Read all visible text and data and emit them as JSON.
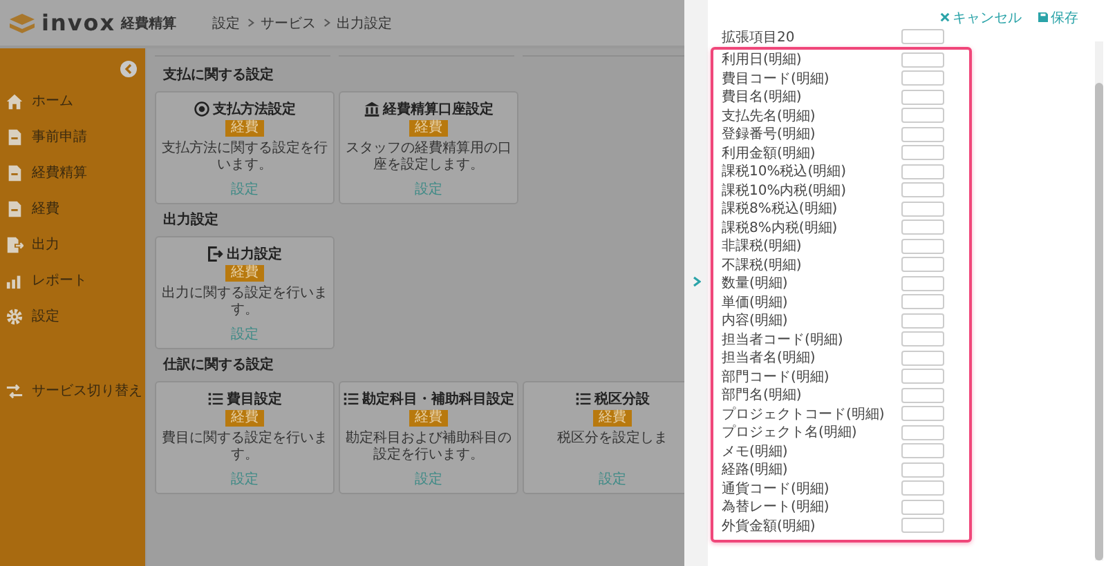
{
  "header": {
    "logo_text": "invox",
    "product": "経費精算",
    "breadcrumb": [
      "設定",
      "サービス",
      "出力設定"
    ]
  },
  "sidebar": {
    "items": [
      {
        "label": "ホーム"
      },
      {
        "label": "事前申請"
      },
      {
        "label": "経費精算"
      },
      {
        "label": "経費"
      },
      {
        "label": "出力"
      },
      {
        "label": "レポート"
      },
      {
        "label": "設定"
      }
    ],
    "footer_item": {
      "label": "サービス切り替え"
    }
  },
  "sections": [
    {
      "title": "支払に関する設定",
      "cards": [
        {
          "title": "支払方法設定",
          "badge": "経費",
          "description": "支払方法に関する設定を行います。",
          "link": "設定"
        },
        {
          "title": "経費精算口座設定",
          "badge": "経費",
          "description": "スタッフの経費精算用の口座を設定します。",
          "link": "設定"
        }
      ]
    },
    {
      "title": "出力設定",
      "cards": [
        {
          "title": "出力設定",
          "badge": "経費",
          "description": "出力に関する設定を行います。",
          "link": "設定"
        }
      ]
    },
    {
      "title": "仕訳に関する設定",
      "cards": [
        {
          "title": "費目設定",
          "badge": "経費",
          "description": "費目に関する設定を行います。",
          "link": "設定"
        },
        {
          "title": "勘定科目・補助科目設定",
          "badge": "経費",
          "description": "勘定科目および補助科目の設定を行います。",
          "link": "設定"
        },
        {
          "title": "税区分設",
          "badge": "経費",
          "description": "税区分を設定しま",
          "link": "設定"
        }
      ]
    }
  ],
  "panel": {
    "actions": [
      {
        "label": "キャンセル",
        "kind": "cancel"
      },
      {
        "label": "保存",
        "kind": "save"
      }
    ],
    "fields": [
      {
        "label": "拡張項目20"
      }
    ],
    "highlighted_fields": [
      {
        "label": "利用日(明細)"
      },
      {
        "label": "費目コード(明細)"
      },
      {
        "label": "費目名(明細)"
      },
      {
        "label": "支払先名(明細)"
      },
      {
        "label": "登録番号(明細)"
      },
      {
        "label": "利用金額(明細)"
      },
      {
        "label": "課税10%税込(明細)"
      },
      {
        "label": "課税10%内税(明細)"
      },
      {
        "label": "課税8%税込(明細)"
      },
      {
        "label": "課税8%内税(明細)"
      },
      {
        "label": "非課税(明細)"
      },
      {
        "label": "不課税(明細)"
      },
      {
        "label": "数量(明細)"
      },
      {
        "label": "単価(明細)"
      },
      {
        "label": "内容(明細)"
      },
      {
        "label": "担当者コード(明細)"
      },
      {
        "label": "担当者名(明細)"
      },
      {
        "label": "部門コード(明細)"
      },
      {
        "label": "部門名(明細)"
      },
      {
        "label": "プロジェクトコード(明細)"
      },
      {
        "label": "プロジェクト名(明細)"
      },
      {
        "label": "メモ(明細)"
      },
      {
        "label": "経路(明細)"
      },
      {
        "label": "通貨コード(明細)"
      },
      {
        "label": "為替レート(明細)"
      },
      {
        "label": "外貨金額(明細)"
      }
    ]
  }
}
